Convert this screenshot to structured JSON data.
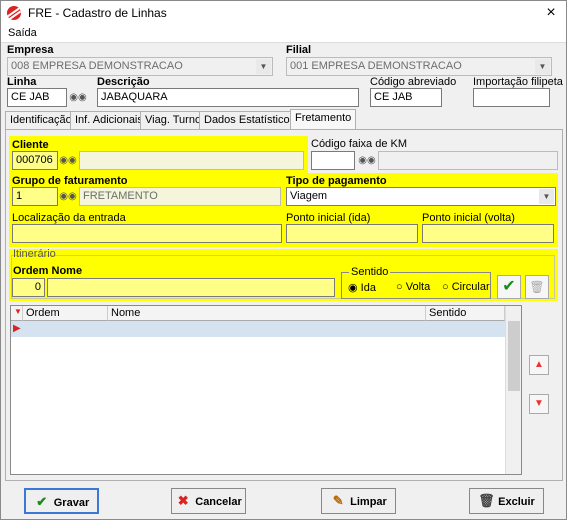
{
  "window": {
    "title": "FRE - Cadastro de Linhas",
    "close": "×"
  },
  "menu": {
    "saida": "Saída"
  },
  "header": {
    "empresa_label": "Empresa",
    "empresa_value": "008 EMPRESA DEMONSTRACAO",
    "filial_label": "Filial",
    "filial_value": "001 EMPRESA DEMONSTRACAO",
    "linha_label": "Linha",
    "linha_value": "CE JAB",
    "descricao_label": "Descrição",
    "descricao_value": "JABAQUARA",
    "codigo_abreviado_label": "Código abreviado",
    "codigo_abreviado_value": "CE JAB",
    "importacao_label": "Importação filipeta",
    "importacao_value": ""
  },
  "tabs": [
    "Identificação",
    "Inf. Adicionais",
    "Viag. Turno",
    "Dados Estatísticos",
    "Fretamento"
  ],
  "fretamento": {
    "cliente_label": "Cliente",
    "cliente_code": "000706",
    "cliente_name": "",
    "codigo_faixa_label": "Código faixa de KM",
    "codigo_faixa_value": "",
    "grupo_label": "Grupo de faturamento",
    "grupo_code": "1",
    "grupo_name": "FRETAMENTO",
    "tipo_pagamento_label": "Tipo de pagamento",
    "tipo_pagamento_value": "Viagem",
    "localizacao_label": "Localização da entrada",
    "localizacao_value": "",
    "ponto_ida_label": "Ponto inicial (ida)",
    "ponto_ida_value": "",
    "ponto_volta_label": "Ponto inicial (volta)",
    "ponto_volta_value": "",
    "itinerario_label": "Itinerário",
    "ordem_nome_label": "Ordem Nome",
    "ordem_value": "0",
    "nome_value": "",
    "sentido_label": "Sentido",
    "sentido_options": [
      "Ida",
      "Volta",
      "Circular"
    ],
    "sentido_selected": "Ida"
  },
  "grid": {
    "columns": [
      "Ordem",
      "Nome",
      "Sentido"
    ]
  },
  "buttons": {
    "gravar": "Gravar",
    "cancelar": "Cancelar",
    "limpar": "Limpar",
    "excluir": "Excluir"
  }
}
